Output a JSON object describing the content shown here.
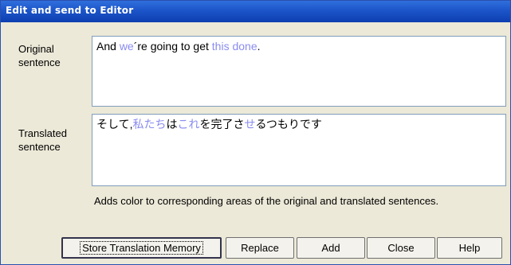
{
  "window": {
    "title": "Edit and send to Editor"
  },
  "original": {
    "label_line1": "Original",
    "label_line2": "sentence",
    "segments": [
      {
        "text": "And ",
        "highlight": false
      },
      {
        "text": "we",
        "highlight": true
      },
      {
        "text": "´re going to get ",
        "highlight": false
      },
      {
        "text": "this done",
        "highlight": true
      },
      {
        "text": ".",
        "highlight": false
      }
    ]
  },
  "translated": {
    "label_line1": "Translated",
    "label_line2": "sentence",
    "segments": [
      {
        "text": "そして,",
        "highlight": false
      },
      {
        "text": "私たち",
        "highlight": true
      },
      {
        "text": "は",
        "highlight": false
      },
      {
        "text": "これ",
        "highlight": true
      },
      {
        "text": "を完了さ",
        "highlight": false
      },
      {
        "text": "せ",
        "highlight": true
      },
      {
        "text": "るつもりです",
        "highlight": false
      }
    ]
  },
  "hint": "Adds color to corresponding areas of the original and translated sentences.",
  "buttons": {
    "store": "Store Translation Memory",
    "replace": "Replace",
    "add": "Add",
    "close": "Close",
    "help": "Help"
  },
  "colors": {
    "highlight": "#8a8cf0",
    "titlebar": "#1c55c9",
    "dialog_bg": "#ece9d8"
  }
}
